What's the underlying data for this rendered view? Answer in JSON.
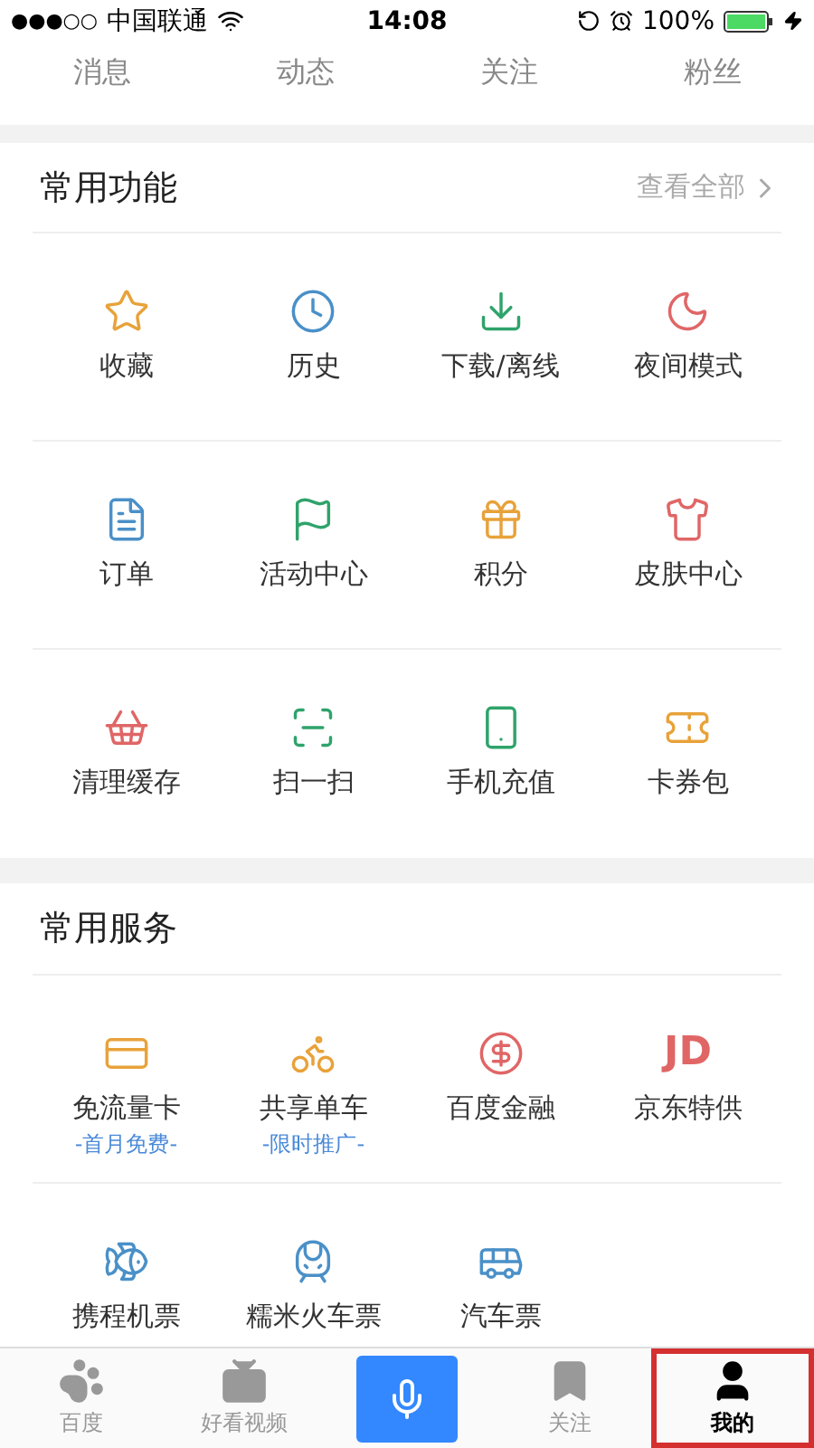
{
  "status_bar": {
    "signal": "●●●○○",
    "carrier": "中国联通",
    "time": "14:08",
    "battery": "100%"
  },
  "stats": [
    "消息",
    "动态",
    "关注",
    "粉丝"
  ],
  "sections": [
    {
      "title": "常用功能",
      "more": "查看全部",
      "items": [
        {
          "label": "收藏",
          "color": "#e8a23a"
        },
        {
          "label": "历史",
          "color": "#4a90c8"
        },
        {
          "label": "下载/离线",
          "color": "#2fa36b"
        },
        {
          "label": "夜间模式",
          "color": "#e06666"
        },
        {
          "label": "订单",
          "color": "#4a90c8"
        },
        {
          "label": "活动中心",
          "color": "#2fa36b"
        },
        {
          "label": "积分",
          "color": "#e8a23a"
        },
        {
          "label": "皮肤中心",
          "color": "#e06666"
        },
        {
          "label": "清理缓存",
          "color": "#e06666"
        },
        {
          "label": "扫一扫",
          "color": "#2fa36b"
        },
        {
          "label": "手机充值",
          "color": "#2fa36b"
        },
        {
          "label": "卡券包",
          "color": "#e8a23a"
        }
      ]
    },
    {
      "title": "常用服务",
      "items": [
        {
          "label": "免流量卡",
          "sub": "-首月免费-",
          "color": "#e8a23a"
        },
        {
          "label": "共享单车",
          "sub": "-限时推广-",
          "color": "#e8a23a"
        },
        {
          "label": "百度金融",
          "color": "#e06666"
        },
        {
          "label": "京东特供",
          "icon_text": "JD",
          "color": "#e06666"
        },
        {
          "label": "携程机票",
          "color": "#4a90c8"
        },
        {
          "label": "糯米火车票",
          "color": "#4a90c8"
        },
        {
          "label": "汽车票",
          "color": "#4a90c8"
        }
      ]
    }
  ],
  "tabs": [
    {
      "kind": "tab",
      "label": "百度",
      "selected": false,
      "highlighted": false
    },
    {
      "kind": "tab",
      "label": "好看视频",
      "selected": false,
      "highlighted": false
    },
    {
      "kind": "mic",
      "selected": false,
      "highlighted": false
    },
    {
      "kind": "tab",
      "label": "关注",
      "selected": false,
      "highlighted": false
    },
    {
      "kind": "tab",
      "label": "我的",
      "selected": true,
      "highlighted": true
    }
  ]
}
